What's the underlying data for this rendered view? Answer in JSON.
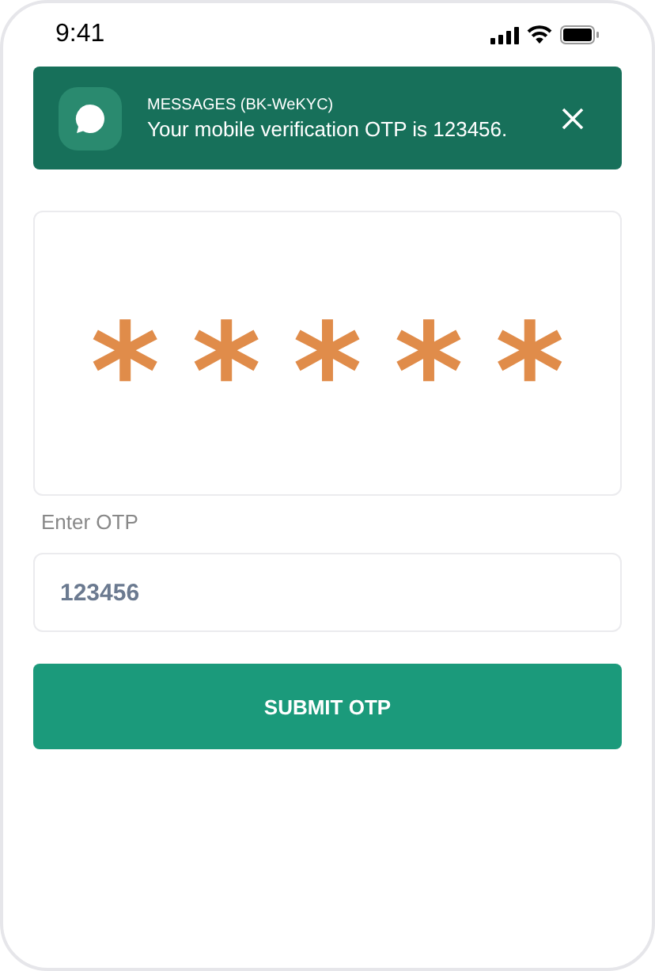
{
  "status_bar": {
    "time": "9:41"
  },
  "notification": {
    "app": "MESSAGES (BK-WeKYC)",
    "message": "Your mobile verification OTP is 123456."
  },
  "otp_display": {
    "masked_digits": [
      "*",
      "*",
      "*",
      "*",
      "*"
    ]
  },
  "otp_field": {
    "label": "Enter OTP",
    "value": "123456"
  },
  "submit_button": {
    "label": "SUBMIT OTP"
  }
}
